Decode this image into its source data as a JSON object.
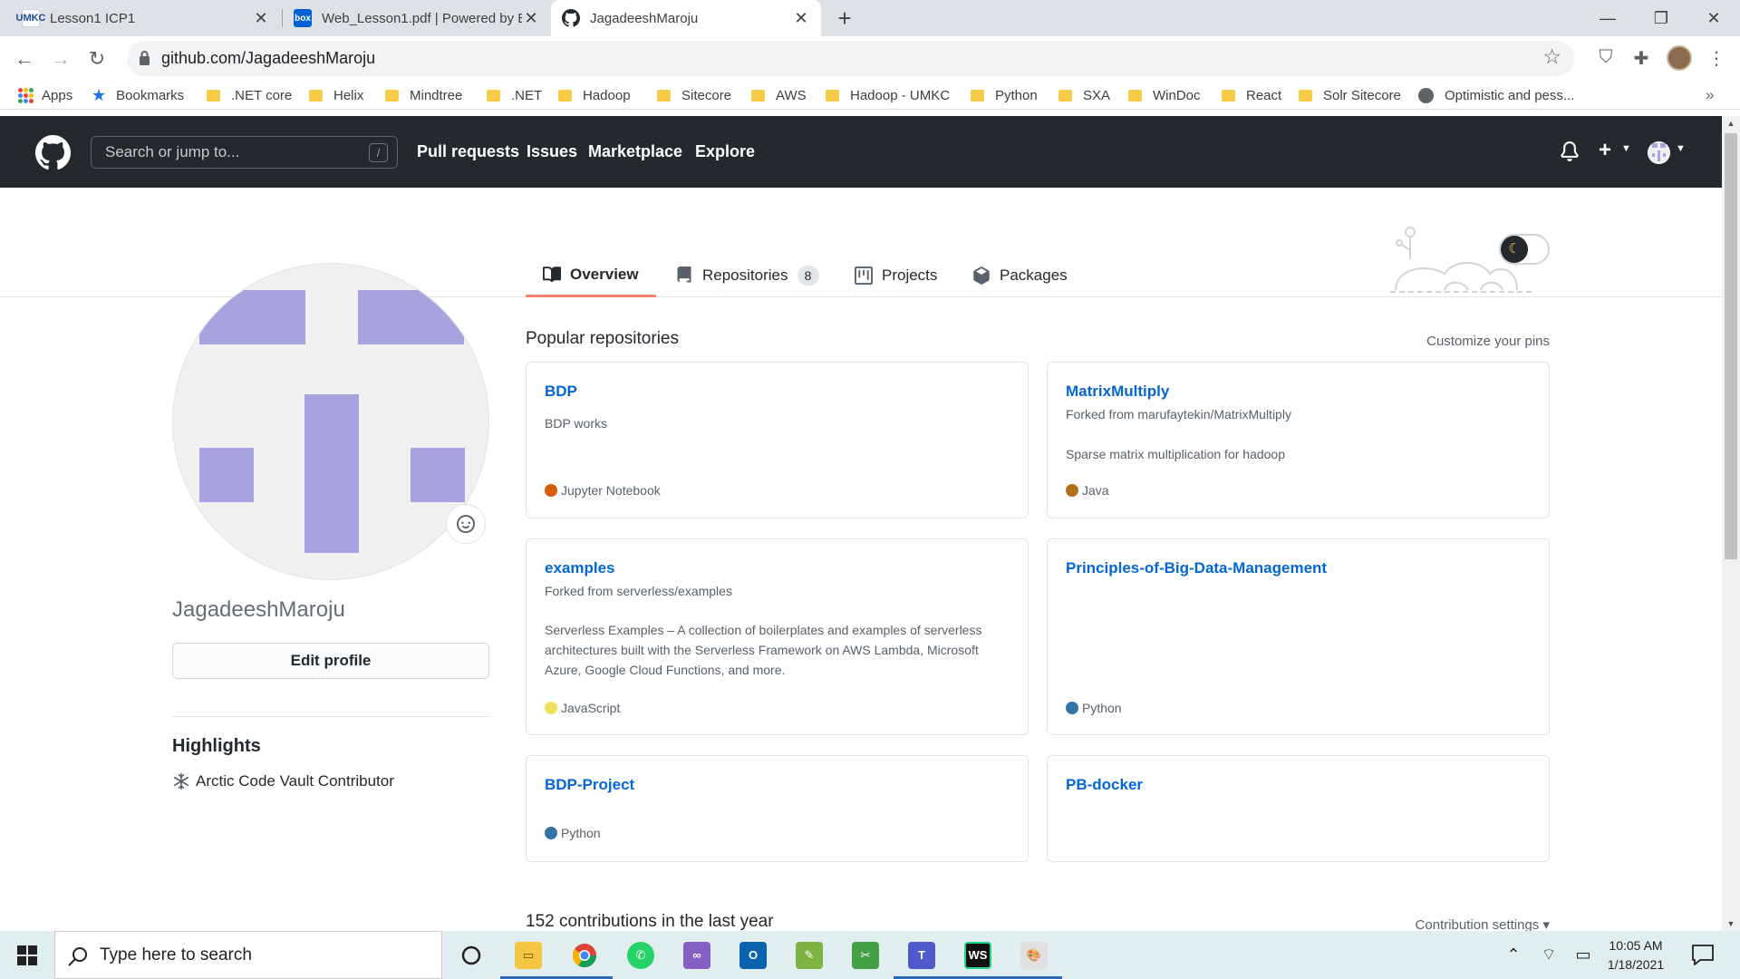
{
  "browser": {
    "tabs": [
      {
        "title": "Lesson1 ICP1",
        "favicon": "umkc-icon",
        "active": false
      },
      {
        "title": "Web_Lesson1.pdf | Powered by B",
        "favicon": "box-icon",
        "active": false
      },
      {
        "title": "JagadeeshMaroju",
        "favicon": "github-icon",
        "active": true
      }
    ],
    "url": "github.com/JagadeeshMaroju",
    "bookmarks": [
      {
        "label": "Apps",
        "icon": "apps-grid-icon"
      },
      {
        "label": "Bookmarks",
        "icon": "star-icon"
      },
      {
        "label": ".NET core",
        "icon": "folder-icon"
      },
      {
        "label": "Helix",
        "icon": "folder-icon"
      },
      {
        "label": "Mindtree",
        "icon": "folder-icon"
      },
      {
        "label": ".NET",
        "icon": "folder-icon"
      },
      {
        "label": "Hadoop",
        "icon": "folder-icon"
      },
      {
        "label": "Sitecore",
        "icon": "folder-icon"
      },
      {
        "label": "AWS",
        "icon": "folder-icon"
      },
      {
        "label": "Hadoop - UMKC",
        "icon": "folder-icon"
      },
      {
        "label": "Python",
        "icon": "folder-icon"
      },
      {
        "label": "SXA",
        "icon": "folder-icon"
      },
      {
        "label": "WinDoc",
        "icon": "folder-icon"
      },
      {
        "label": "React",
        "icon": "folder-icon"
      },
      {
        "label": "Solr Sitecore",
        "icon": "folder-icon"
      },
      {
        "label": "Optimistic and pess...",
        "icon": "globe-icon"
      }
    ],
    "bookmarks_more": "»"
  },
  "github": {
    "search_placeholder": "Search or jump to...",
    "search_shortcut": "/",
    "nav": [
      "Pull requests",
      "Issues",
      "Marketplace",
      "Explore"
    ],
    "profile_tabs": [
      {
        "label": "Overview",
        "icon": "book-icon",
        "selected": true
      },
      {
        "label": "Repositories",
        "icon": "repo-icon",
        "count": "8"
      },
      {
        "label": "Projects",
        "icon": "project-icon"
      },
      {
        "label": "Packages",
        "icon": "package-icon"
      }
    ],
    "username": "JagadeeshMaroju",
    "edit_profile": "Edit profile",
    "highlights_title": "Highlights",
    "highlight_item": "Arctic Code Vault Contributor",
    "popular_title": "Popular repositories",
    "customize_pins": "Customize your pins",
    "repos": [
      {
        "name": "BDP",
        "fork": "",
        "description": "BDP works",
        "language": "Jupyter Notebook",
        "lang_color": "#DA5B0B"
      },
      {
        "name": "MatrixMultiply",
        "fork": "Forked from marufaytekin/MatrixMultiply",
        "description": "Sparse matrix multiplication for hadoop",
        "language": "Java",
        "lang_color": "#b07219"
      },
      {
        "name": "examples",
        "fork": "Forked from serverless/examples",
        "description": "Serverless Examples – A collection of boilerplates and examples of serverless architectures built with the Serverless Framework on AWS Lambda, Microsoft Azure, Google Cloud Functions, and more.",
        "language": "JavaScript",
        "lang_color": "#f1e05a"
      },
      {
        "name": "Principles-of-Big-Data-Management",
        "fork": "",
        "description": "",
        "language": "Python",
        "lang_color": "#3572A5"
      },
      {
        "name": "BDP-Project",
        "fork": "",
        "description": "",
        "language": "Python",
        "lang_color": "#3572A5"
      },
      {
        "name": "PB-docker",
        "fork": "",
        "description": "",
        "language": "",
        "lang_color": ""
      }
    ],
    "contributions_title": "152 contributions in the last year",
    "contribution_settings": "Contribution settings ▾"
  },
  "taskbar": {
    "search_placeholder": "Type here to search",
    "apps": [
      "cortana-icon",
      "file-explorer-icon",
      "chrome-icon",
      "whatsapp-icon",
      "visual-studio-icon",
      "outlook-icon",
      "notepad-plus-icon",
      "snipping-tool-icon",
      "teams-icon",
      "webstorm-icon",
      "paint-icon"
    ],
    "time": "10:05 AM",
    "date": "1/18/2021"
  }
}
